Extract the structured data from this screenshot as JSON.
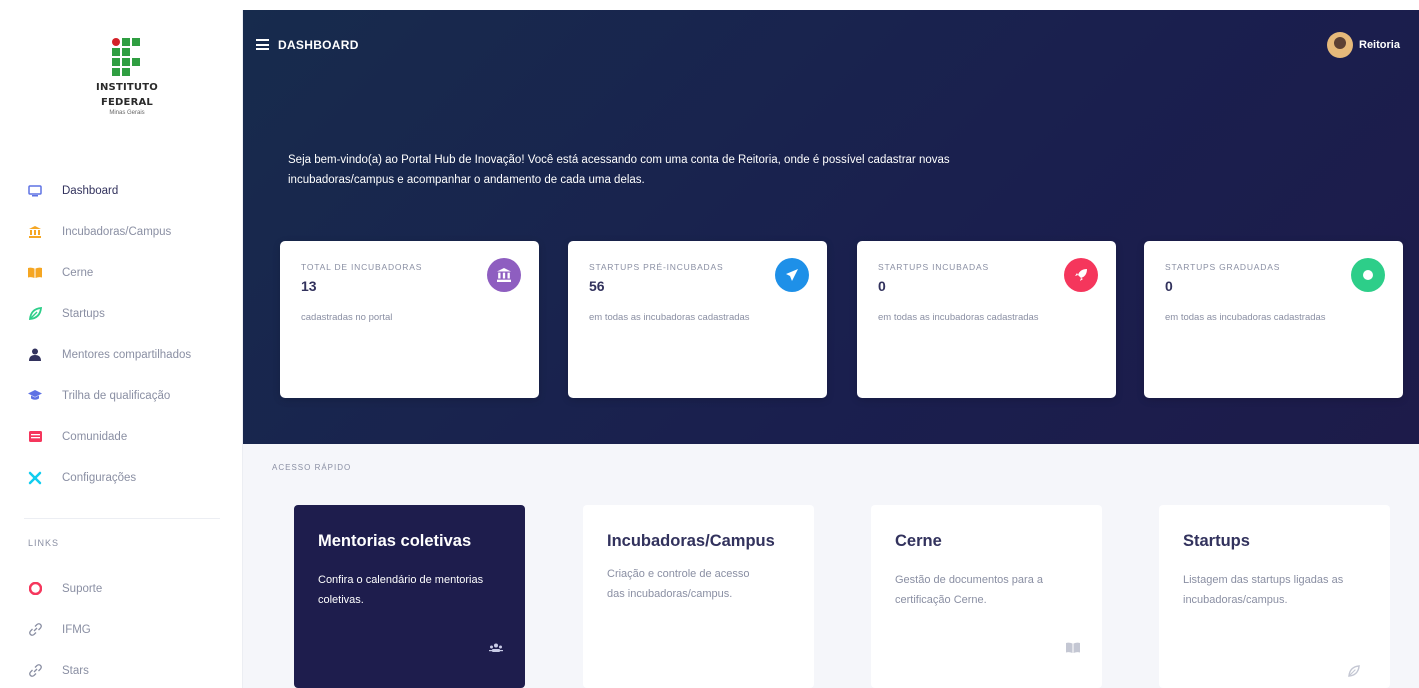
{
  "brand": {
    "line1": "INSTITUTO",
    "line2": "FEDERAL",
    "line3": "Minas Gerais"
  },
  "sidebar": {
    "items": [
      {
        "label": "Dashboard",
        "icon": "monitor-icon",
        "color": "#5e72e4"
      },
      {
        "label": "Incubadoras/Campus",
        "icon": "bank-icon",
        "color": "#f5a623"
      },
      {
        "label": "Cerne",
        "icon": "book-icon",
        "color": "#f5a623"
      },
      {
        "label": "Startups",
        "icon": "leaf-icon",
        "color": "#2dce89"
      },
      {
        "label": "Mentores compartilhados",
        "icon": "users-icon",
        "color": "#32325d"
      },
      {
        "label": "Trilha de qualificação",
        "icon": "graduation-cap-icon",
        "color": "#5e72e4"
      },
      {
        "label": "Comunidade",
        "icon": "community-icon",
        "color": "#f5365c"
      },
      {
        "label": "Configurações",
        "icon": "puzzle-icon",
        "color": "#11cdef"
      }
    ],
    "links_heading": "LINKS",
    "links": [
      {
        "label": "Suporte",
        "icon": "support-icon",
        "color": "#f5365c"
      },
      {
        "label": "IFMG",
        "icon": "link-icon",
        "color": "#8a8fa3"
      },
      {
        "label": "Stars",
        "icon": "link-icon",
        "color": "#8a8fa3"
      }
    ]
  },
  "header": {
    "title": "DASHBOARD",
    "user_name": "Reitoria"
  },
  "welcome": {
    "text": "Seja bem-vindo(a) ao Portal Hub de Inovação! Você está acessando com uma conta de Reitoria, onde é possível cadastrar novas incubadoras/campus e acompanhar o andamento de cada uma delas."
  },
  "stats": [
    {
      "label": "TOTAL DE INCUBADORAS",
      "value": "13",
      "desc": "cadastradas no portal",
      "icon": "bank-icon",
      "color": "#8e5ec0"
    },
    {
      "label": "STARTUPS PRÉ-INCUBADAS",
      "value": "56",
      "desc": "em todas as incubadoras cadastradas",
      "icon": "paper-plane-icon",
      "color": "#1e90e8"
    },
    {
      "label": "STARTUPS INCUBADAS",
      "value": "0",
      "desc": "em todas as incubadoras cadastradas",
      "icon": "rocket-icon",
      "color": "#f5365c"
    },
    {
      "label": "STARTUPS GRADUADAS",
      "value": "0",
      "desc": "em todas as incubadoras cadastradas",
      "icon": "badge-icon",
      "color": "#2dce89"
    }
  ],
  "quick_access": {
    "heading": "ACESSO RÁPIDO",
    "cards": [
      {
        "title": "Mentorias coletivas",
        "desc": "Confira o calendário de mentorias coletivas.",
        "icon": "group-icon"
      },
      {
        "title": "Incubadoras/Campus",
        "desc": "Criação e controle de acesso das incubadoras/campus.",
        "icon": "bank-icon"
      },
      {
        "title": "Cerne",
        "desc": "Gestão de documentos para a certificação Cerne.",
        "icon": "book-icon"
      },
      {
        "title": "Startups",
        "desc": "Listagem das startups ligadas as incubadoras/campus.",
        "icon": "leaf-icon"
      }
    ]
  }
}
